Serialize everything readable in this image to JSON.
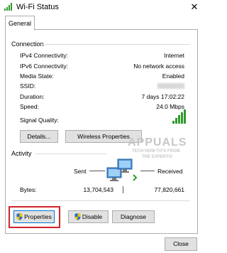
{
  "window": {
    "title": "Wi-Fi Status",
    "close_glyph": "✕"
  },
  "tabs": [
    {
      "label": "General"
    }
  ],
  "connection": {
    "heading": "Connection",
    "rows": [
      {
        "label": "IPv4 Connectivity:",
        "value": "Internet"
      },
      {
        "label": "IPv6 Connectivity:",
        "value": "No network access"
      },
      {
        "label": "Media State:",
        "value": "Enabled"
      },
      {
        "label": "SSID:",
        "value": ""
      },
      {
        "label": "Duration:",
        "value": "7 days 17:02:22"
      },
      {
        "label": "Speed:",
        "value": "24.0 Mbps"
      }
    ],
    "signal_label": "Signal Quality:",
    "signal_bars_lit": 5,
    "signal_bars_total": 5,
    "details_button": "Details...",
    "wireless_button": "Wireless Properties"
  },
  "activity": {
    "heading": "Activity",
    "sent_label": "Sent",
    "received_label": "Received",
    "bytes_label": "Bytes:",
    "bytes_sent": "13,704,543",
    "bytes_received": "77,820,661"
  },
  "actions": {
    "properties": "Properties",
    "disable": "Disable",
    "diagnose": "Diagnose"
  },
  "footer": {
    "close": "Close"
  },
  "watermark": {
    "line1": "APPUALS",
    "line2": "TECH HOW-TO'S FROM",
    "line3": "THE EXPERTS!"
  },
  "colors": {
    "accent": "#0078d7",
    "highlight": "#d2232a",
    "signal": "#2e9b2e"
  }
}
